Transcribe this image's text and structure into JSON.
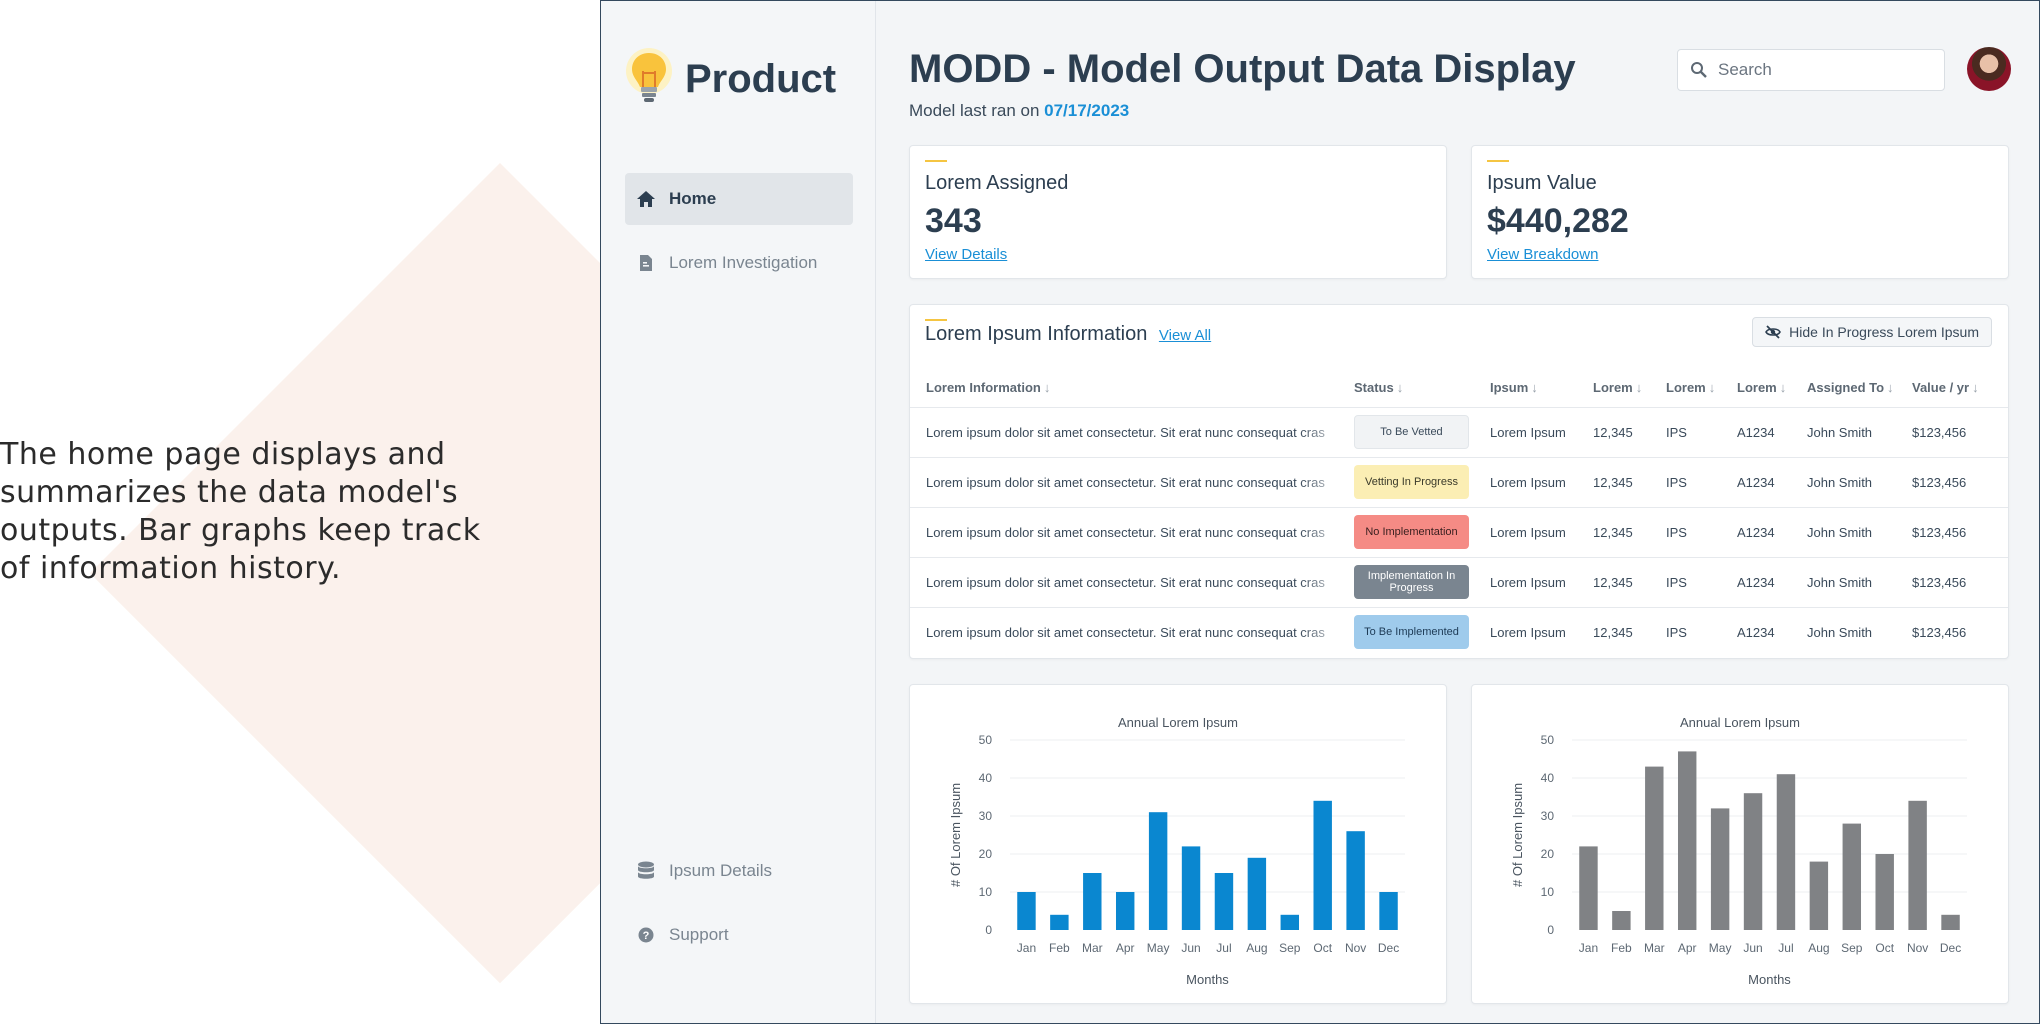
{
  "caption": "The home page displays and summarizes the data model's outputs. Bar graphs keep track of information history.",
  "brand": {
    "name": "Product"
  },
  "nav": {
    "home": "Home",
    "investigation": "Lorem Investigation",
    "details": "Ipsum Details",
    "support": "Support"
  },
  "header": {
    "title": "MODD - Model Output Data Display",
    "subtitle_prefix": "Model last ran on ",
    "date": "07/17/2023",
    "search_placeholder": "Search"
  },
  "kpis": [
    {
      "title": "Lorem Assigned",
      "value": "343",
      "link": "View Details"
    },
    {
      "title": "Ipsum Value",
      "value": "$440,282",
      "link": "View Breakdown"
    }
  ],
  "table": {
    "title": "Lorem Ipsum Information",
    "view_all": "View All",
    "hide_button": "Hide In Progress Lorem Ipsum",
    "columns": [
      "Lorem Information",
      "Status",
      "Ipsum",
      "Lorem",
      "Lorem",
      "Lorem",
      "Assigned To",
      "Value / yr"
    ],
    "rows": [
      {
        "info": "Lorem ipsum dolor sit amet consectetur. Sit erat nunc consequat cras",
        "status": "To Be Vetted",
        "status_color": "#f1f3f5",
        "status_text": "#3a4a5a",
        "ipsum": "Lorem Ipsum",
        "n": "12,345",
        "code": "IPS",
        "id": "A1234",
        "assigned": "John Smith",
        "value": "$123,456"
      },
      {
        "info": "Lorem ipsum dolor sit amet consectetur. Sit erat nunc consequat cras",
        "status": "Vetting In Progress",
        "status_color": "#fbeeb4",
        "status_text": "#3a3a2a",
        "ipsum": "Lorem Ipsum",
        "n": "12,345",
        "code": "IPS",
        "id": "A1234",
        "assigned": "John Smith",
        "value": "$123,456"
      },
      {
        "info": "Lorem ipsum dolor sit amet consectetur. Sit erat nunc consequat cras",
        "status": "No Implementation",
        "status_color": "#f58b85",
        "status_text": "#3a2020",
        "ipsum": "Lorem Ipsum",
        "n": "12,345",
        "code": "IPS",
        "id": "A1234",
        "assigned": "John Smith",
        "value": "$123,456"
      },
      {
        "info": "Lorem ipsum dolor sit amet consectetur. Sit erat nunc consequat cras",
        "status": "Implementation In Progress",
        "status_color": "#7a8590",
        "status_text": "#ffffff",
        "ipsum": "Lorem Ipsum",
        "n": "12,345",
        "code": "IPS",
        "id": "A1234",
        "assigned": "John Smith",
        "value": "$123,456"
      },
      {
        "info": "Lorem ipsum dolor sit amet consectetur. Sit erat nunc consequat cras",
        "status": "To Be Implemented",
        "status_color": "#9fcbec",
        "status_text": "#1d3a55",
        "ipsum": "Lorem Ipsum",
        "n": "12,345",
        "code": "IPS",
        "id": "A1234",
        "assigned": "John Smith",
        "value": "$123,456"
      }
    ]
  },
  "colors": {
    "accent": "#f5c542",
    "link": "#1a8fd6",
    "bar_blue": "#0a87d0",
    "bar_gray": "#808285",
    "navy": "#2c3e50"
  },
  "chart_data": [
    {
      "type": "bar",
      "title": "Annual Lorem Ipsum",
      "xlabel": "Months",
      "ylabel": "# Of Lorem Ipsum",
      "categories": [
        "Jan",
        "Feb",
        "Mar",
        "Apr",
        "May",
        "Jun",
        "Jul",
        "Aug",
        "Sep",
        "Oct",
        "Nov",
        "Dec"
      ],
      "values": [
        10,
        4,
        15,
        10,
        31,
        22,
        15,
        19,
        4,
        34,
        26,
        10
      ],
      "ylim": [
        0,
        50
      ],
      "yticks": [
        0,
        10,
        20,
        30,
        40,
        50
      ],
      "grid": true,
      "color": "#0a87d0"
    },
    {
      "type": "bar",
      "title": "Annual Lorem Ipsum",
      "xlabel": "Months",
      "ylabel": "# Of Lorem Ipsum",
      "categories": [
        "Jan",
        "Feb",
        "Mar",
        "Apr",
        "May",
        "Jun",
        "Jul",
        "Aug",
        "Sep",
        "Oct",
        "Nov",
        "Dec"
      ],
      "values": [
        22,
        5,
        43,
        47,
        32,
        36,
        41,
        18,
        28,
        20,
        34,
        4
      ],
      "ylim": [
        0,
        50
      ],
      "yticks": [
        0,
        10,
        20,
        30,
        40,
        50
      ],
      "grid": true,
      "color": "#808285"
    }
  ]
}
